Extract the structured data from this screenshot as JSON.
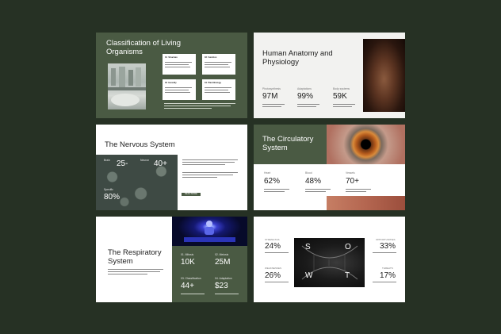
{
  "slides": {
    "s1": {
      "title": "Classification of Living Organisms",
      "boxes": [
        {
          "num": "01",
          "label": "Structure"
        },
        {
          "num": "02",
          "label": "Function"
        },
        {
          "num": "03",
          "label": "Heredity"
        },
        {
          "num": "04",
          "label": "Plant Biology"
        }
      ]
    },
    "s2": {
      "title": "Human Anatomy and Physiology",
      "stats": [
        {
          "label": "Photosynthesis",
          "value": "97M"
        },
        {
          "label": "Adaptations",
          "value": "99%"
        },
        {
          "label": "Body systems",
          "value": "59K"
        }
      ]
    },
    "s3": {
      "title": "The Nervous System",
      "stats": [
        {
          "label": "Brain",
          "value": "25-"
        },
        {
          "label": "Neuron",
          "value": "40+"
        },
        {
          "label": "Specific",
          "value": "80%"
        }
      ],
      "button": "READ MORE"
    },
    "s4": {
      "title": "The Circulatory System",
      "stats": [
        {
          "label": "Heart",
          "value": "62%"
        },
        {
          "label": "Blood",
          "value": "48%"
        },
        {
          "label": "Vessels",
          "value": "70+"
        }
      ]
    },
    "s5": {
      "title": "The Respiratory System",
      "stats": [
        {
          "label": "01. Mitosis",
          "value": "10K"
        },
        {
          "label": "02. Meiosis",
          "value": "25M"
        },
        {
          "label": "03. Classification",
          "value": "44+"
        },
        {
          "label": "04. Adaptation",
          "value": "$23"
        }
      ]
    },
    "s6": {
      "letters": [
        "S",
        "O",
        "W",
        "T"
      ],
      "stats": [
        {
          "label": "STRENGTHS",
          "value": "24%"
        },
        {
          "label": "WEAKNESSES",
          "value": "26%"
        },
        {
          "label": "OPPORTUNITIES",
          "value": "33%"
        },
        {
          "label": "THREATS",
          "value": "17%"
        }
      ]
    }
  },
  "colors": {
    "background": "#263124",
    "green": "#4a5a43"
  }
}
